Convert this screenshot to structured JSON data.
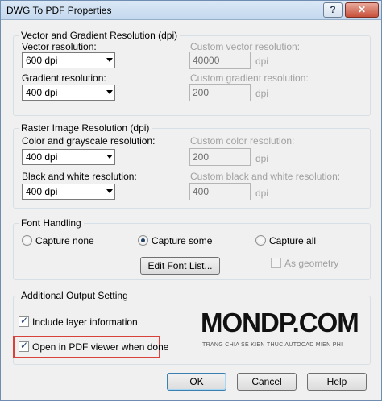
{
  "window": {
    "title": "DWG To PDF Properties",
    "help_label": "?",
    "close_label": "✕"
  },
  "vector": {
    "group_title": "Vector and Gradient Resolution (dpi)",
    "vector_label": "Vector resolution:",
    "vector_value": "600 dpi",
    "custom_vector_label": "Custom vector resolution:",
    "custom_vector_value": "40000",
    "gradient_label": "Gradient resolution:",
    "gradient_value": "400 dpi",
    "custom_gradient_label": "Custom gradient resolution:",
    "custom_gradient_value": "200",
    "unit": "dpi"
  },
  "raster": {
    "group_title": "Raster Image Resolution (dpi)",
    "color_label": "Color and grayscale resolution:",
    "color_value": "400 dpi",
    "custom_color_label": "Custom color resolution:",
    "custom_color_value": "200",
    "bw_label": "Black and white resolution:",
    "bw_value": "400 dpi",
    "custom_bw_label": "Custom black and white resolution:",
    "custom_bw_value": "400",
    "unit": "dpi"
  },
  "font": {
    "group_title": "Font Handling",
    "capture_none": "Capture none",
    "capture_some": "Capture some",
    "capture_all": "Capture all",
    "selected": "capture_some",
    "edit_font_list": "Edit Font List...",
    "as_geometry": "As geometry"
  },
  "additional": {
    "group_title": "Additional Output Setting",
    "include_layer": "Include layer information",
    "include_layer_checked": true,
    "open_viewer": "Open in PDF viewer when done",
    "open_viewer_checked": true
  },
  "watermark": {
    "main": "MONDP.COM",
    "sub": "TRANG CHIA SE KIEN THUC AUTOCAD MIEN PHI"
  },
  "buttons": {
    "ok": "OK",
    "cancel": "Cancel",
    "help": "Help"
  },
  "colors": {
    "highlight": "#d9423a",
    "window_bg": "#f0f0f0"
  }
}
